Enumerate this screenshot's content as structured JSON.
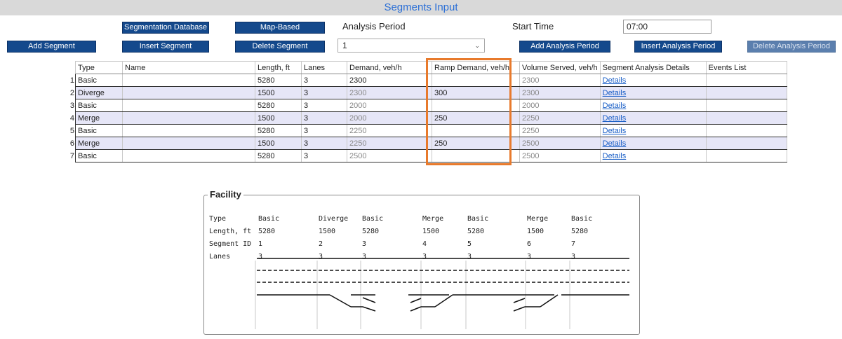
{
  "window": {
    "title": "Segments Input"
  },
  "toolbar": {
    "segmentation_database": "Segmentation Database",
    "map_based_segmentation": "Map-Based Segmentation",
    "analysis_period_label": "Analysis Period",
    "start_time_label": "Start Time",
    "start_time_value": "07:00",
    "add_segment": "Add Segment",
    "insert_segment": "Insert Segment",
    "delete_segment": "Delete Segment",
    "analysis_period_value": "1",
    "add_analysis_period": "Add Analysis Period",
    "insert_analysis_period": "Insert Analysis Period",
    "delete_analysis_period": "Delete Analysis Period"
  },
  "grid": {
    "columns": [
      "Type",
      "Name",
      "Length, ft",
      "Lanes",
      "Demand, veh/h",
      "Ramp Demand, veh/h",
      "Volume Served, veh/h",
      "Segment Analysis Details",
      "Events List"
    ],
    "rows": [
      {
        "num": "1",
        "type": "Basic",
        "name": "",
        "length": "5280",
        "lanes": "3",
        "demand": "2300",
        "ramp": "",
        "served": "2300",
        "details": "Details",
        "events": ""
      },
      {
        "num": "2",
        "type": "Diverge",
        "name": "",
        "length": "1500",
        "lanes": "3",
        "demand": "2300",
        "ramp": "300",
        "served": "2300",
        "details": "Details",
        "events": ""
      },
      {
        "num": "3",
        "type": "Basic",
        "name": "",
        "length": "5280",
        "lanes": "3",
        "demand": "2000",
        "ramp": "",
        "served": "2000",
        "details": "Details",
        "events": ""
      },
      {
        "num": "4",
        "type": "Merge",
        "name": "",
        "length": "1500",
        "lanes": "3",
        "demand": "2000",
        "ramp": "250",
        "served": "2250",
        "details": "Details",
        "events": ""
      },
      {
        "num": "5",
        "type": "Basic",
        "name": "",
        "length": "5280",
        "lanes": "3",
        "demand": "2250",
        "ramp": "",
        "served": "2250",
        "details": "Details",
        "events": ""
      },
      {
        "num": "6",
        "type": "Merge",
        "name": "",
        "length": "1500",
        "lanes": "3",
        "demand": "2250",
        "ramp": "250",
        "served": "2500",
        "details": "Details",
        "events": ""
      },
      {
        "num": "7",
        "type": "Basic",
        "name": "",
        "length": "5280",
        "lanes": "3",
        "demand": "2500",
        "ramp": "",
        "served": "2500",
        "details": "Details",
        "events": ""
      }
    ]
  },
  "facility": {
    "title": "Facility",
    "row_labels": [
      "Type",
      "Length, ft",
      "Segment ID",
      "Lanes"
    ],
    "segments": [
      {
        "type": "Basic",
        "length": "5280",
        "id": "1",
        "lanes": "3"
      },
      {
        "type": "Diverge",
        "length": "1500",
        "id": "2",
        "lanes": "3"
      },
      {
        "type": "Basic",
        "length": "5280",
        "id": "3",
        "lanes": "3"
      },
      {
        "type": "Merge",
        "length": "1500",
        "id": "4",
        "lanes": "3"
      },
      {
        "type": "Basic",
        "length": "5280",
        "id": "5",
        "lanes": "3"
      },
      {
        "type": "Merge",
        "length": "1500",
        "id": "6",
        "lanes": "3"
      },
      {
        "type": "Basic",
        "length": "5280",
        "id": "7",
        "lanes": "3"
      }
    ]
  },
  "colors": {
    "button": "#14498c",
    "highlight": "#e87a2c",
    "alt_row": "#e6e6f7",
    "title_text": "#2b6fd6"
  }
}
